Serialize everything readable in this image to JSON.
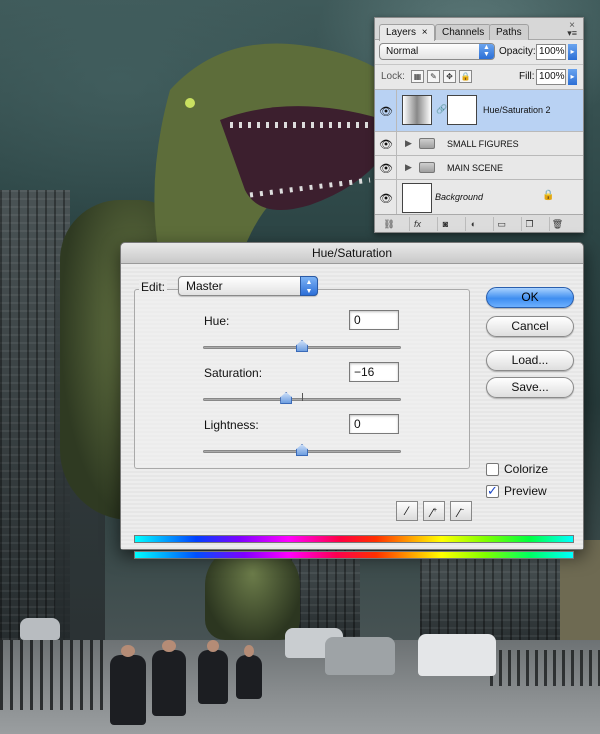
{
  "layers_panel": {
    "tabs": [
      {
        "label": "Layers",
        "close": "×"
      },
      {
        "label": "Channels"
      },
      {
        "label": "Paths"
      }
    ],
    "panel_close": "×",
    "blend_mode": "Normal",
    "opacity_label": "Opacity:",
    "opacity_value": "100%",
    "lock_label": "Lock:",
    "fill_label": "Fill:",
    "fill_value": "100%",
    "layers": [
      {
        "name": "Hue/Saturation 2",
        "selected": true,
        "type": "adjustment"
      },
      {
        "name": "SMALL FIGURES",
        "type": "group"
      },
      {
        "name": "MAIN SCENE",
        "type": "group"
      },
      {
        "name": "Background",
        "type": "background",
        "locked": true
      }
    ],
    "footer_icons": [
      "link-icon",
      "fx-icon",
      "mask-icon",
      "adjustment-icon",
      "group-icon",
      "new-layer-icon",
      "trash-icon"
    ],
    "fx_label": "fx"
  },
  "dialog": {
    "title": "Hue/Saturation",
    "edit_label": "Edit:",
    "edit_value": "Master",
    "hue_label": "Hue:",
    "hue_value": "0",
    "saturation_label": "Saturation:",
    "saturation_value": "−16",
    "lightness_label": "Lightness:",
    "lightness_value": "0",
    "buttons": {
      "ok": "OK",
      "cancel": "Cancel",
      "load": "Load...",
      "save": "Save..."
    },
    "colorize_label": "Colorize",
    "colorize_checked": false,
    "preview_label": "Preview",
    "preview_checked": true,
    "hue_level": 0,
    "saturation_level": -16,
    "lightness_level": 0
  },
  "colors": {
    "selection": "#b9d2f3",
    "accent_blue": "#3f8ef0"
  }
}
